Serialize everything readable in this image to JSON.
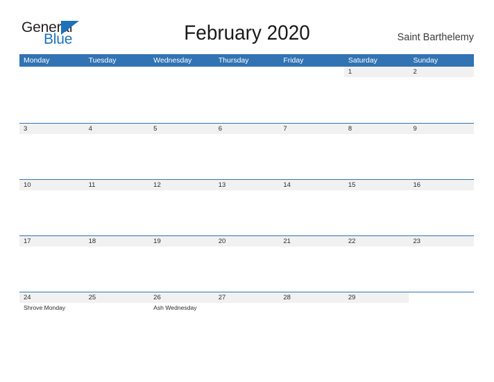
{
  "brand": {
    "name_part1": "General",
    "name_part2": "Blue",
    "triangle_icon": "blue-triangle-icon",
    "accent_color": "#1d71b8"
  },
  "header": {
    "title": "February 2020",
    "subtitle": "Saint Barthelemy"
  },
  "theme": {
    "header_blue": "#3173b3",
    "band_gray": "#f1f1f1",
    "text_dark": "#2b2b2b",
    "page_background": "#ffffff"
  },
  "calendar": {
    "month": "February",
    "year": "2020",
    "region": "Saint Barthelemy",
    "weekdays": [
      "Monday",
      "Tuesday",
      "Wednesday",
      "Thursday",
      "Friday",
      "Saturday",
      "Sunday"
    ],
    "weeks": [
      [
        {
          "number": "",
          "events": []
        },
        {
          "number": "",
          "events": []
        },
        {
          "number": "",
          "events": []
        },
        {
          "number": "",
          "events": []
        },
        {
          "number": "",
          "events": []
        },
        {
          "number": "1",
          "events": []
        },
        {
          "number": "2",
          "events": []
        }
      ],
      [
        {
          "number": "3",
          "events": []
        },
        {
          "number": "4",
          "events": []
        },
        {
          "number": "5",
          "events": []
        },
        {
          "number": "6",
          "events": []
        },
        {
          "number": "7",
          "events": []
        },
        {
          "number": "8",
          "events": []
        },
        {
          "number": "9",
          "events": []
        }
      ],
      [
        {
          "number": "10",
          "events": []
        },
        {
          "number": "11",
          "events": []
        },
        {
          "number": "12",
          "events": []
        },
        {
          "number": "13",
          "events": []
        },
        {
          "number": "14",
          "events": []
        },
        {
          "number": "15",
          "events": []
        },
        {
          "number": "16",
          "events": []
        }
      ],
      [
        {
          "number": "17",
          "events": []
        },
        {
          "number": "18",
          "events": []
        },
        {
          "number": "19",
          "events": []
        },
        {
          "number": "20",
          "events": []
        },
        {
          "number": "21",
          "events": []
        },
        {
          "number": "22",
          "events": []
        },
        {
          "number": "23",
          "events": []
        }
      ],
      [
        {
          "number": "24",
          "events": [
            "Shrove Monday"
          ]
        },
        {
          "number": "25",
          "events": []
        },
        {
          "number": "26",
          "events": [
            "Ash Wednesday"
          ]
        },
        {
          "number": "27",
          "events": []
        },
        {
          "number": "28",
          "events": []
        },
        {
          "number": "29",
          "events": []
        },
        {
          "number": "",
          "events": []
        }
      ]
    ]
  }
}
